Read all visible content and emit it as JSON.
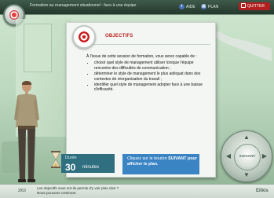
{
  "header": {
    "app_title": "Formation au management situationnel : face à une équipe",
    "menu": [
      {
        "label": "AIDE",
        "icon": "help-icon"
      },
      {
        "label": "PLAN",
        "icon": "plan-icon"
      }
    ],
    "quit_label": "QUITTER"
  },
  "card": {
    "title": "OBJECTIFS",
    "intro": "À l'issue de cette session de formation, vous serez capable de :",
    "items": [
      "choisir quel style de management utiliser lorsque l'équipe rencontre des difficultés de communication ;",
      "déterminer le style de management le plus adéquat dans des contextes de réorganisation du travail ;",
      "identifier quel style de management adopter face à une baisse d'efficacité."
    ]
  },
  "duration": {
    "label": "Durée",
    "value": "30",
    "unit": "minutes"
  },
  "callout": {
    "text_before": "Cliquez sur le bouton",
    "emphasis": "SUIVANT pour afficher le plan."
  },
  "controls": {
    "next_label": "SUIVANT"
  },
  "footer": {
    "pager": "2/63",
    "subtitle_line1": "Les objectifs vous ont-ils permis d'y voir plus clair ?",
    "subtitle_line2": "Nous pouvons continuer.",
    "brand": "Elikis"
  },
  "colors": {
    "accent_red": "#b81f1f",
    "callout_blue": "#3b84c4",
    "duration_teal": "#2f6f7f"
  }
}
